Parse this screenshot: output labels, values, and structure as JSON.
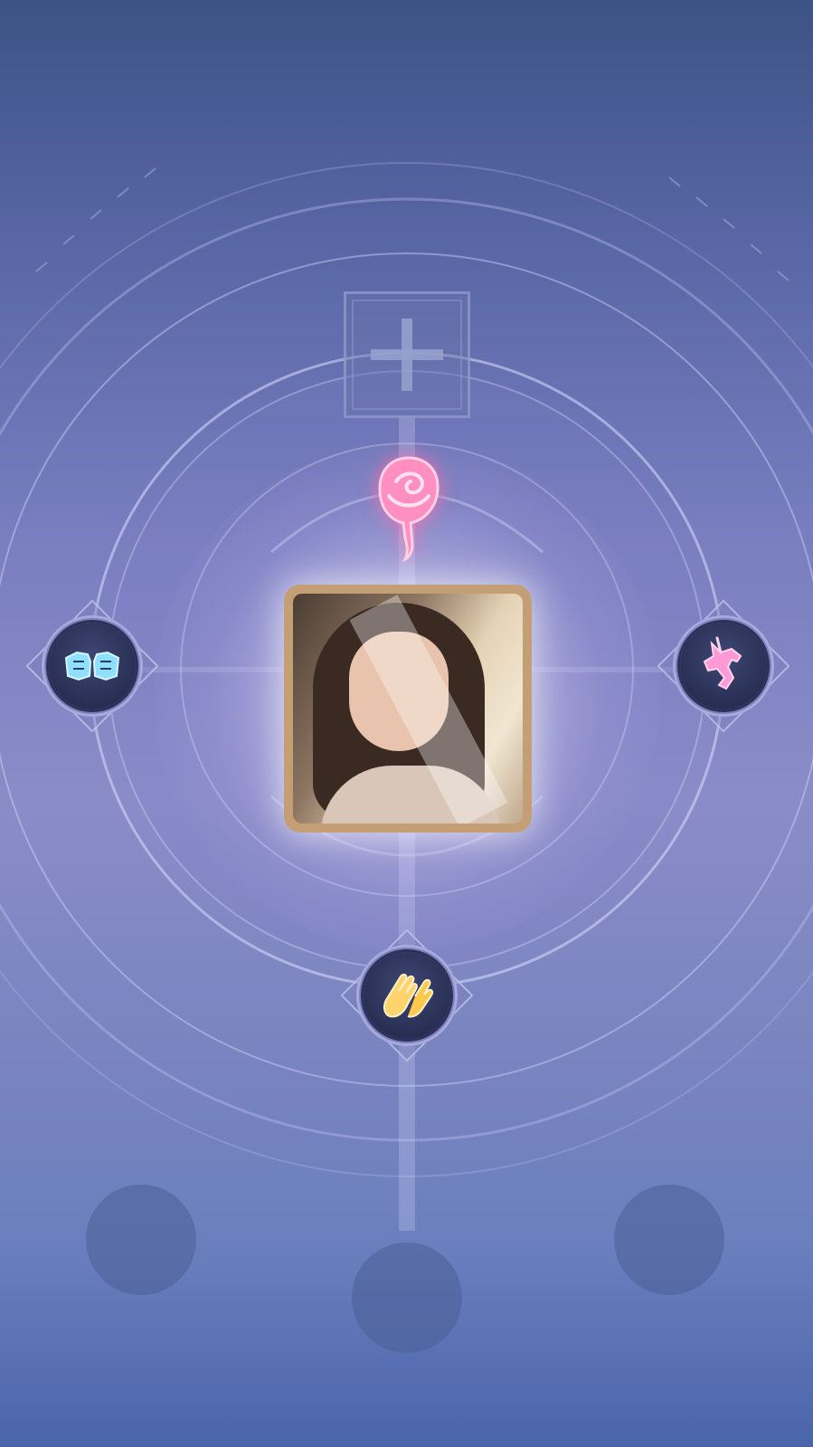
{
  "center_avatar": {
    "label": ""
  },
  "add_slot": {
    "icon": "plus-icon"
  },
  "emotes": [
    {
      "name": "rose",
      "icon": "rose-icon",
      "color": "#ff8fc1"
    },
    {
      "name": "fist-bump",
      "icon": "fist-bump-icon",
      "color": "#8fe0ff"
    },
    {
      "name": "unicorn",
      "icon": "unicorn-icon",
      "color": "#ff9ad6"
    },
    {
      "name": "clapping-hands",
      "icon": "clapping-hands-icon",
      "color": "#ffd36e"
    }
  ],
  "empty_slots": 3,
  "colors": {
    "background_top": "#3d5286",
    "background_mid": "#8a8cc8",
    "frame_gold": "#c49e74",
    "badge_core": "#1f2546"
  }
}
